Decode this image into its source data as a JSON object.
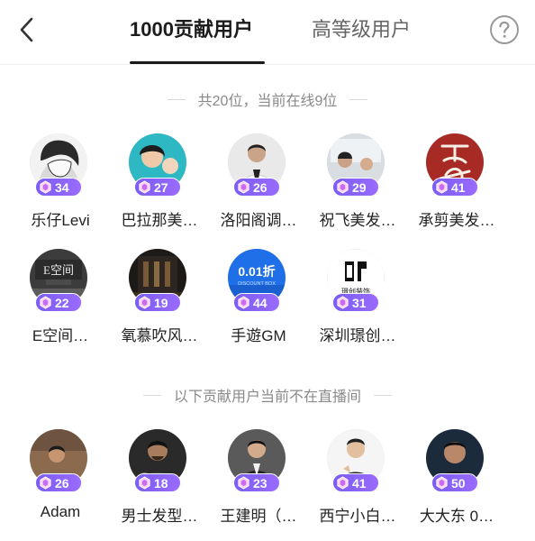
{
  "header": {
    "tab_active": "1000贡献用户",
    "tab_inactive": "高等级用户"
  },
  "online_section": {
    "summary": "共20位，当前在线9位"
  },
  "offline_section": {
    "heading": "以下贡献用户当前不在直播间"
  },
  "colors": {
    "badge": "#8a63f7",
    "accent": "#1a1a1a",
    "muted": "#8a8a8a"
  },
  "online_users": [
    {
      "name": "乐仔Levi",
      "level": "34",
      "icon": "avatar-photo"
    },
    {
      "name": "巴拉那美…",
      "level": "27",
      "icon": "avatar-photo"
    },
    {
      "name": "洛阳阁调…",
      "level": "26",
      "icon": "avatar-photo"
    },
    {
      "name": "祝飞美发…",
      "level": "29",
      "icon": "avatar-photo"
    },
    {
      "name": "承剪美发…",
      "level": "41",
      "icon": "avatar-photo"
    },
    {
      "name": "E空间…",
      "level": "22",
      "icon": "avatar-photo"
    },
    {
      "name": "氧慕吹风…",
      "level": "19",
      "icon": "avatar-photo"
    },
    {
      "name": "手遊GM",
      "level": "44",
      "icon": "avatar-photo",
      "avatar_text": "0.01折",
      "avatar_subtext": "DISCOUNT BOX"
    },
    {
      "name": "深圳璟创…",
      "level": "31",
      "icon": "avatar-logo",
      "avatar_text": "璟创装饰"
    }
  ],
  "offline_users": [
    {
      "name": "Adam",
      "level": "26",
      "icon": "avatar-photo"
    },
    {
      "name": "男士发型…",
      "level": "18",
      "icon": "avatar-photo"
    },
    {
      "name": "王建明（…",
      "level": "23",
      "icon": "avatar-photo"
    },
    {
      "name": "西宁小白…",
      "level": "41",
      "icon": "avatar-photo"
    },
    {
      "name": "大大东 0…",
      "level": "50",
      "icon": "avatar-photo"
    }
  ]
}
